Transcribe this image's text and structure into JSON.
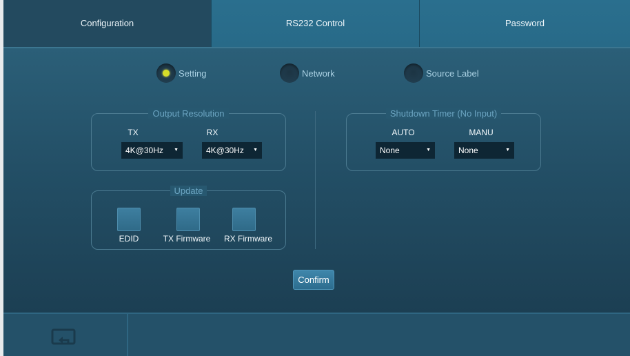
{
  "tabs": [
    {
      "label": "Configuration",
      "active": true
    },
    {
      "label": "RS232 Control",
      "active": false
    },
    {
      "label": "Password",
      "active": false
    }
  ],
  "radios": [
    {
      "label": "Setting",
      "selected": true
    },
    {
      "label": "Network",
      "selected": false
    },
    {
      "label": "Source Label",
      "selected": false
    }
  ],
  "output_resolution": {
    "title": "Output Resolution",
    "tx_label": "TX",
    "rx_label": "RX",
    "tx_value": "4K@30Hz",
    "rx_value": "4K@30Hz"
  },
  "update": {
    "title": "Update",
    "buttons": [
      "EDID",
      "TX Firmware",
      "RX Firmware"
    ]
  },
  "shutdown_timer": {
    "title": "Shutdown Timer (No Input)",
    "auto_label": "AUTO",
    "manu_label": "MANU",
    "auto_value": "None",
    "manu_value": "None"
  },
  "confirm_label": "Confirm",
  "footer": {
    "back_icon": "return-icon"
  }
}
